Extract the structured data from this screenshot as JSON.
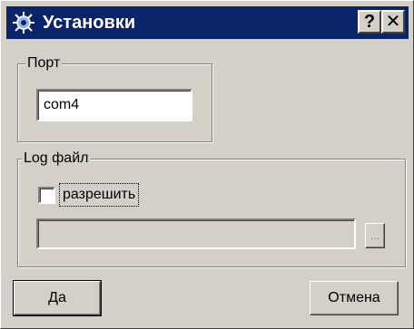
{
  "window": {
    "title": "Установки",
    "help_button": "?",
    "close_button": "✕"
  },
  "port_group": {
    "legend": "Порт",
    "value": "com4"
  },
  "log_group": {
    "legend": "Log файл",
    "enable_label": "разрешить",
    "enable_checked": false,
    "path_value": "",
    "browse_label": "..."
  },
  "buttons": {
    "ok_label": "Да",
    "cancel_label": "Отмена"
  },
  "colors": {
    "titlebar": "#0a246a",
    "face": "#d4d0c8"
  },
  "icons": {
    "app": "settings-gear-icon"
  }
}
